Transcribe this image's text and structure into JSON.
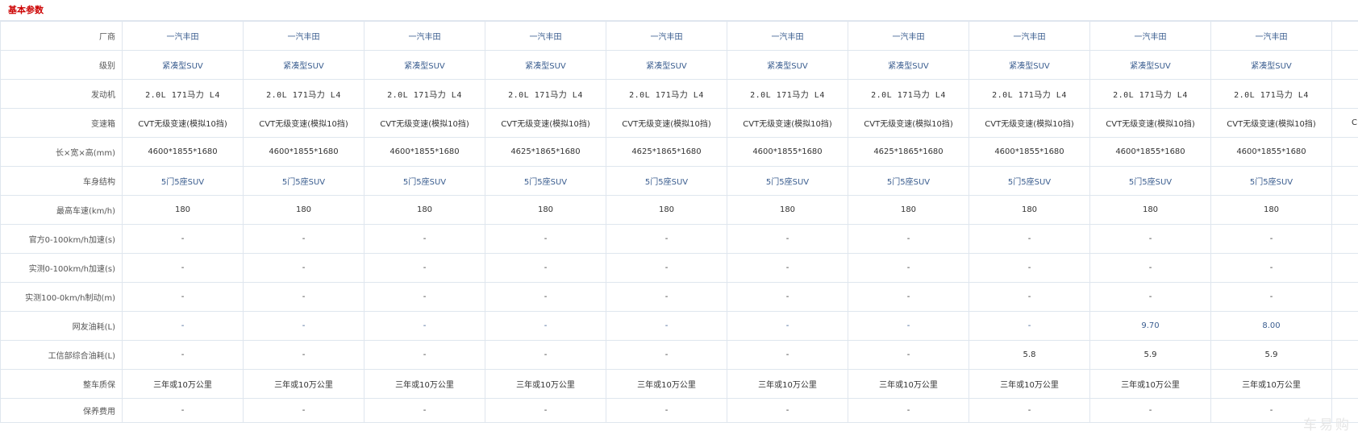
{
  "section_title": "基本参数",
  "rows": [
    {
      "label": "厂商",
      "values": [
        "一汽丰田",
        "一汽丰田",
        "一汽丰田",
        "一汽丰田",
        "一汽丰田",
        "一汽丰田",
        "一汽丰田",
        "一汽丰田",
        "一汽丰田",
        "一汽丰田"
      ],
      "extra": ""
    },
    {
      "label": "级别",
      "values": [
        "紧凑型SUV",
        "紧凑型SUV",
        "紧凑型SUV",
        "紧凑型SUV",
        "紧凑型SUV",
        "紧凑型SUV",
        "紧凑型SUV",
        "紧凑型SUV",
        "紧凑型SUV",
        "紧凑型SUV"
      ],
      "extra": ""
    },
    {
      "label": "发动机",
      "values": [
        "2.0L 171马力 L4",
        "2.0L 171马力 L4",
        "2.0L 171马力 L4",
        "2.0L 171马力 L4",
        "2.0L 171马力 L4",
        "2.0L 171马力 L4",
        "2.0L 171马力 L4",
        "2.0L 171马力 L4",
        "2.0L 171马力 L4",
        "2.0L 171马力 L4"
      ],
      "extra": ""
    },
    {
      "label": "变速箱",
      "values": [
        "CVT无级变速(模拟10挡)",
        "CVT无级变速(模拟10挡)",
        "CVT无级变速(模拟10挡)",
        "CVT无级变速(模拟10挡)",
        "CVT无级变速(模拟10挡)",
        "CVT无级变速(模拟10挡)",
        "CVT无级变速(模拟10挡)",
        "CVT无级变速(模拟10挡)",
        "CVT无级变速(模拟10挡)",
        "CVT无级变速(模拟10挡)"
      ],
      "extra": "C"
    },
    {
      "label": "长×宽×高(mm)",
      "values": [
        "4600*1855*1680",
        "4600*1855*1680",
        "4600*1855*1680",
        "4625*1865*1680",
        "4625*1865*1680",
        "4600*1855*1680",
        "4625*1865*1680",
        "4600*1855*1680",
        "4600*1855*1680",
        "4600*1855*1680"
      ],
      "extra": ""
    },
    {
      "label": "车身结构",
      "values": [
        "5门5座SUV",
        "5门5座SUV",
        "5门5座SUV",
        "5门5座SUV",
        "5门5座SUV",
        "5门5座SUV",
        "5门5座SUV",
        "5门5座SUV",
        "5门5座SUV",
        "5门5座SUV"
      ],
      "extra": ""
    },
    {
      "label": "最高车速(km/h)",
      "values": [
        "180",
        "180",
        "180",
        "180",
        "180",
        "180",
        "180",
        "180",
        "180",
        "180"
      ],
      "extra": ""
    },
    {
      "label": "官方0-100km/h加速(s)",
      "values": [
        "-",
        "-",
        "-",
        "-",
        "-",
        "-",
        "-",
        "-",
        "-",
        "-"
      ],
      "extra": ""
    },
    {
      "label": "实测0-100km/h加速(s)",
      "values": [
        "-",
        "-",
        "-",
        "-",
        "-",
        "-",
        "-",
        "-",
        "-",
        "-"
      ],
      "extra": ""
    },
    {
      "label": "实测100-0km/h制动(m)",
      "values": [
        "-",
        "-",
        "-",
        "-",
        "-",
        "-",
        "-",
        "-",
        "-",
        "-"
      ],
      "extra": ""
    },
    {
      "label": "网友油耗(L)",
      "values": [
        "-",
        "-",
        "-",
        "-",
        "-",
        "-",
        "-",
        "-",
        "9.70",
        "8.00"
      ],
      "extra": ""
    },
    {
      "label": "工信部综合油耗(L)",
      "values": [
        "-",
        "-",
        "-",
        "-",
        "-",
        "-",
        "-",
        "5.8",
        "5.9",
        "5.9"
      ],
      "extra": ""
    },
    {
      "label": "整车质保",
      "values": [
        "三年或10万公里",
        "三年或10万公里",
        "三年或10万公里",
        "三年或10万公里",
        "三年或10万公里",
        "三年或10万公里",
        "三年或10万公里",
        "三年或10万公里",
        "三年或10万公里",
        "三年或10万公里"
      ],
      "extra": ""
    },
    {
      "label": "保养费用",
      "values": [
        "-",
        "-",
        "-",
        "-",
        "-",
        "-",
        "-",
        "-",
        "-",
        "-"
      ],
      "extra": ""
    }
  ],
  "watermark": "车易购"
}
